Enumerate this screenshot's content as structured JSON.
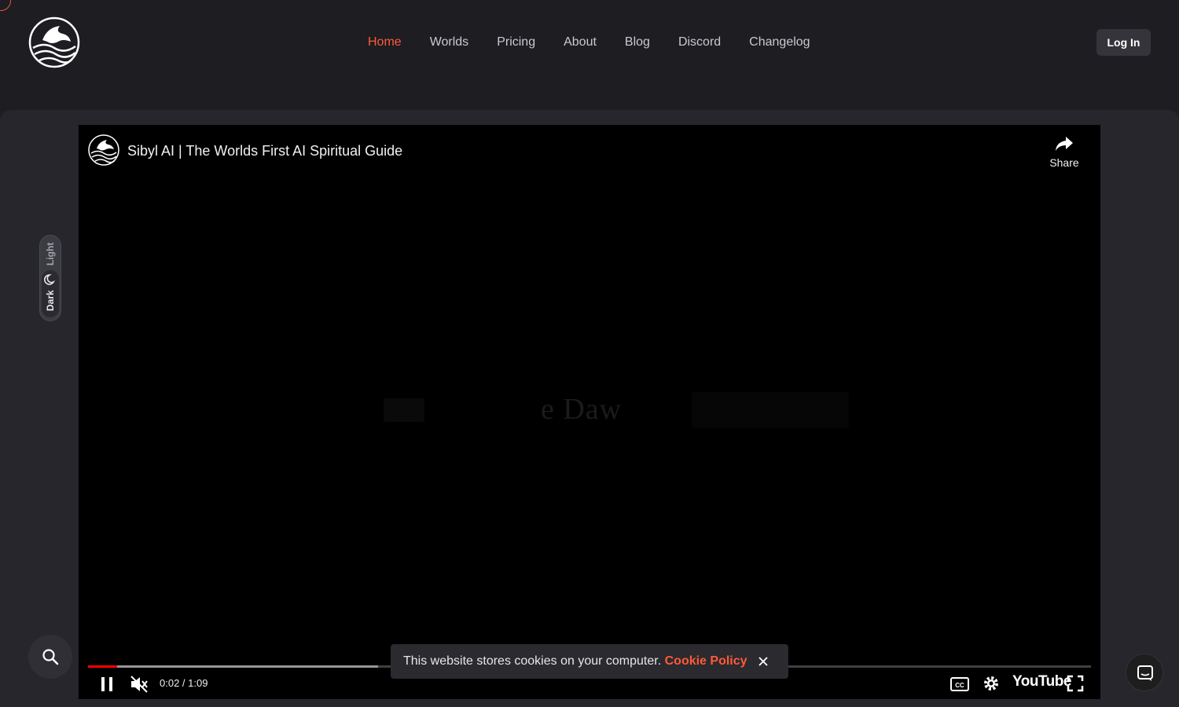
{
  "header": {
    "nav": [
      {
        "label": "Home",
        "active": true
      },
      {
        "label": "Worlds"
      },
      {
        "label": "Pricing"
      },
      {
        "label": "About"
      },
      {
        "label": "Blog"
      },
      {
        "label": "Discord"
      },
      {
        "label": "Changelog"
      }
    ],
    "login_label": "Log In",
    "accent_color": "#ff5a36"
  },
  "video": {
    "title": "Sibyl AI | The Worlds First AI Spiritual Guide",
    "share_label": "Share",
    "overlay_text": "e Daw",
    "time": "0:02 / 1:09",
    "played_fraction": 0.029,
    "buffered_fraction": 0.289,
    "youtube_label": "YouTube",
    "icons": [
      "pause-icon",
      "muted-icon",
      "captions-icon",
      "settings-icon",
      "fullscreen-icon",
      "share-icon"
    ]
  },
  "theme_toggle": {
    "light_label": "Light",
    "dark_label": "Dark",
    "selected": "Dark"
  },
  "cookie": {
    "text": "This website stores cookies on your computer.",
    "link_label": "Cookie Policy"
  }
}
